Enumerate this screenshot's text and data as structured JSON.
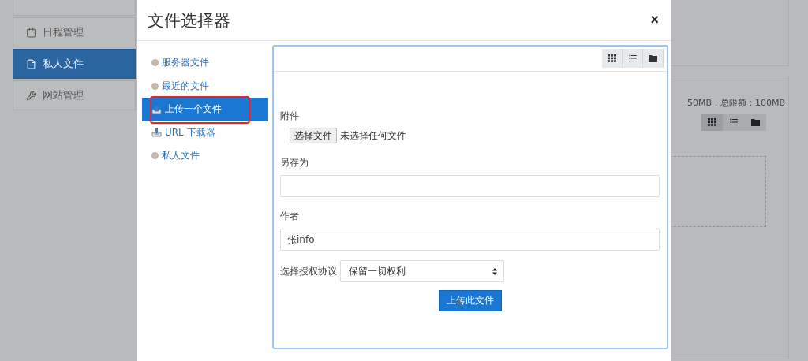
{
  "background": {
    "nav": [
      {
        "label": "日程管理",
        "kind": "calendar",
        "selected": false
      },
      {
        "label": "私人文件",
        "kind": "file",
        "selected": true
      },
      {
        "label": "网站管理",
        "kind": "wrench",
        "selected": false
      }
    ],
    "quota_text": "：50MB，总限额：100MB",
    "view_buttons": [
      {
        "kind": "grid",
        "selected": true
      },
      {
        "kind": "list",
        "selected": false
      },
      {
        "kind": "folder",
        "selected": false
      }
    ]
  },
  "dialog": {
    "title": "文件选择器",
    "close": "×",
    "repositories": [
      {
        "label": "服务器文件",
        "kind": "dot",
        "selected": false,
        "annotated": false
      },
      {
        "label": "最近的文件",
        "kind": "dot",
        "selected": false,
        "annotated": false
      },
      {
        "label": "上传一个文件",
        "kind": "upload",
        "selected": true,
        "annotated": true
      },
      {
        "label": "URL 下载器",
        "kind": "download",
        "selected": false,
        "annotated": false
      },
      {
        "label": "私人文件",
        "kind": "dot",
        "selected": false,
        "annotated": false
      }
    ],
    "view_buttons": [
      {
        "kind": "grid"
      },
      {
        "kind": "list"
      },
      {
        "kind": "folder"
      }
    ],
    "form": {
      "attachment_label": "附件",
      "choose_button": "选择文件",
      "no_file": "未选择任何文件",
      "save_as_label": "另存为",
      "author_label": "作者",
      "author_value": "张info",
      "license_label": "选择授权协议",
      "license_value": "保留一切权利",
      "submit": "上传此文件"
    }
  }
}
